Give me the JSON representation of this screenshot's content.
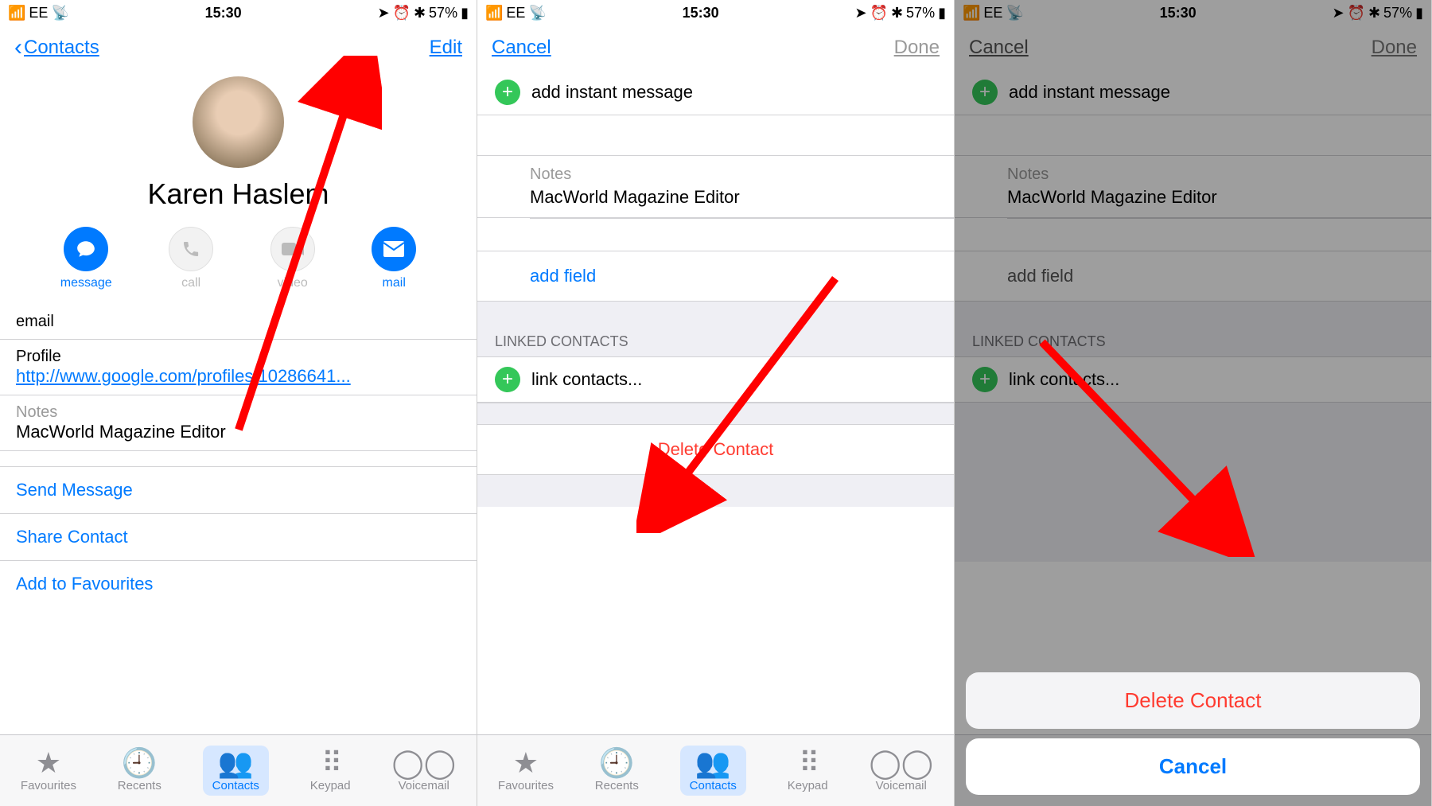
{
  "status": {
    "carrier": "EE",
    "time": "15:30",
    "battery": "57%"
  },
  "screen1": {
    "back": "Contacts",
    "edit": "Edit",
    "name": "Karen Haslem",
    "actions": {
      "message": "message",
      "call": "call",
      "video": "video",
      "mail": "mail"
    },
    "email_label": "email",
    "profile_label": "Profile",
    "profile_url": "http://www.google.com/profiles/10286641...",
    "notes_label": "Notes",
    "notes_value": "MacWorld Magazine Editor",
    "send_message": "Send Message",
    "share_contact": "Share Contact",
    "add_fav": "Add to Favourites"
  },
  "screen2": {
    "cancel": "Cancel",
    "done": "Done",
    "add_im": "add instant message",
    "notes_label": "Notes",
    "notes_value": "MacWorld Magazine Editor",
    "add_field": "add field",
    "linked_header": "LINKED CONTACTS",
    "link_contacts": "link contacts...",
    "delete": "Delete Contact"
  },
  "screen3": {
    "cancel": "Cancel",
    "done": "Done",
    "add_im": "add instant message",
    "notes_label": "Notes",
    "notes_value": "MacWorld Magazine Editor",
    "add_field": "add field",
    "linked_header": "LINKED CONTACTS",
    "link_contacts": "link contacts...",
    "sheet_delete": "Delete Contact",
    "sheet_cancel": "Cancel"
  },
  "tabs": {
    "favourites": "Favourites",
    "recents": "Recents",
    "contacts": "Contacts",
    "keypad": "Keypad",
    "voicemail": "Voicemail"
  }
}
